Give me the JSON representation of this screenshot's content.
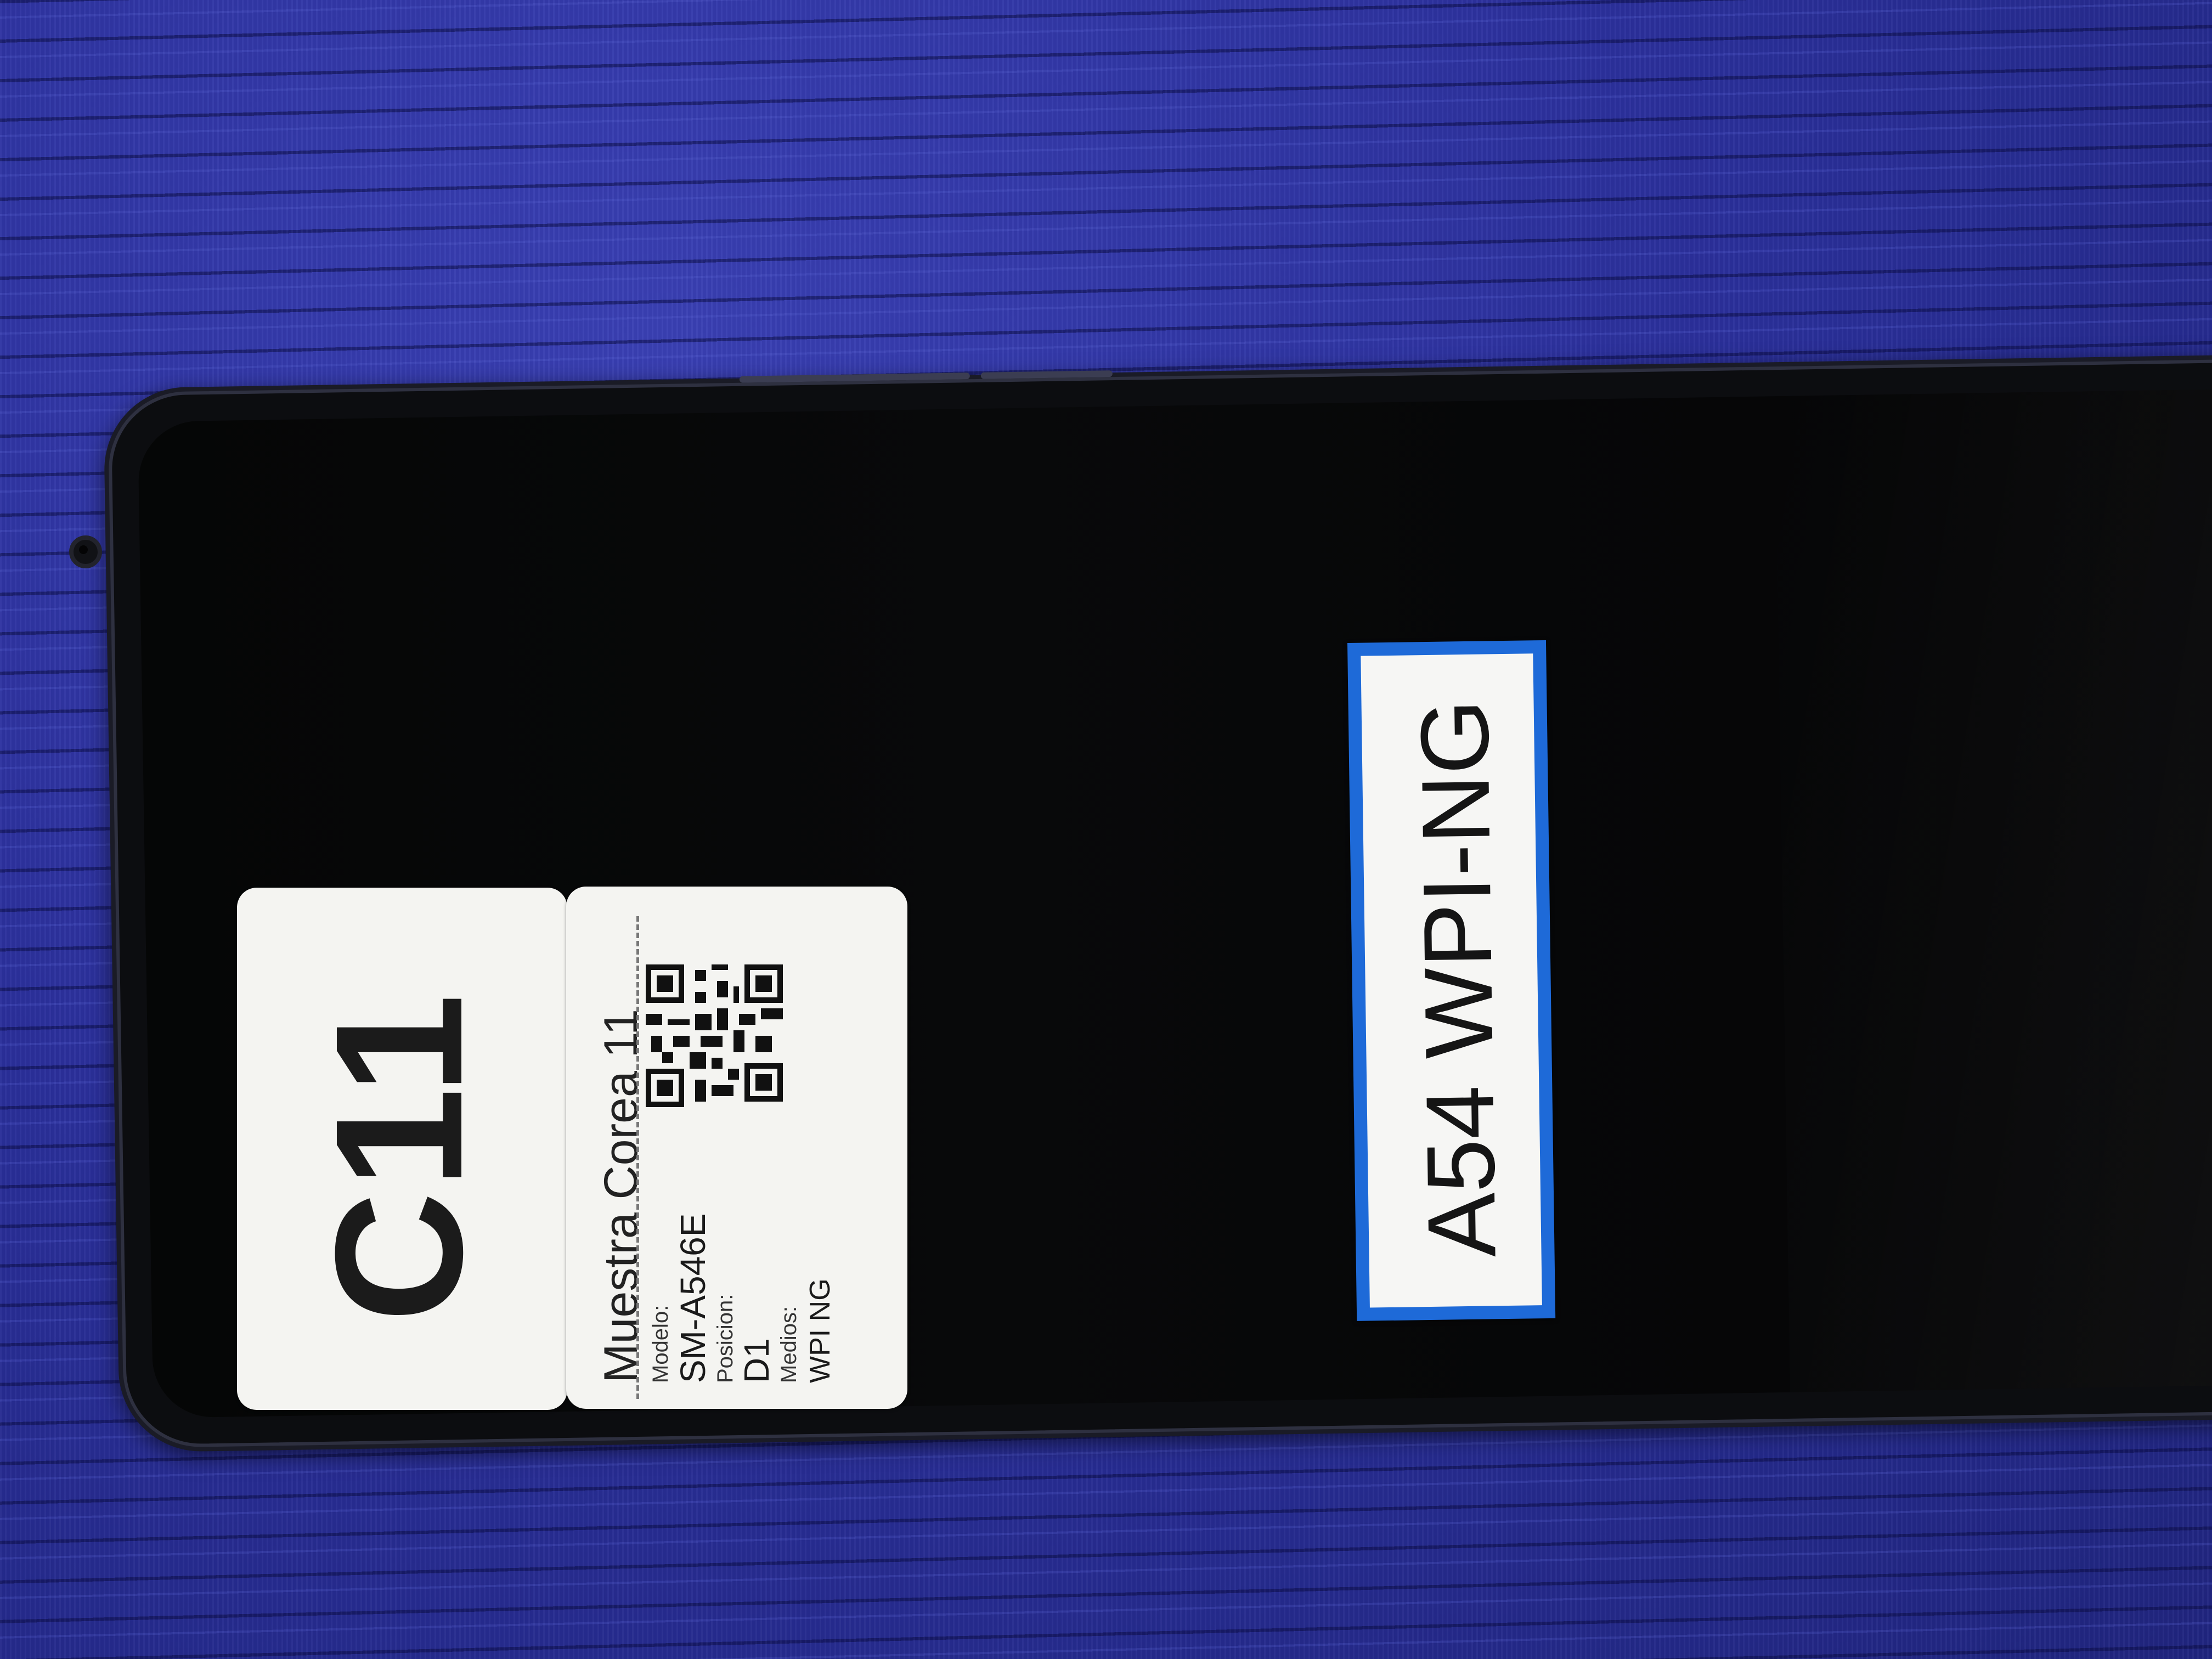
{
  "image": {
    "subject": "phone-with-sample-labels"
  },
  "colors": {
    "background_fabric": "#2a2f9a",
    "phone_body": "#1a1b26",
    "screen": "#050606",
    "sticker": "#f4f4f1",
    "label_border": "#1e6ad8"
  },
  "sticker_id": {
    "code": "C11"
  },
  "sticker_info": {
    "title": "Muestra Corea 11",
    "model_label": "Modelo:",
    "model_value": "SM-A546E",
    "position_label": "Posicion:",
    "position_value": "D1",
    "media_label": "Medios:",
    "media_value": "WPI NG"
  },
  "screen_label": {
    "text": "A54 WPI-NG"
  },
  "icons": {
    "camera": "front-camera-icon",
    "qr": "qr-code-icon"
  }
}
